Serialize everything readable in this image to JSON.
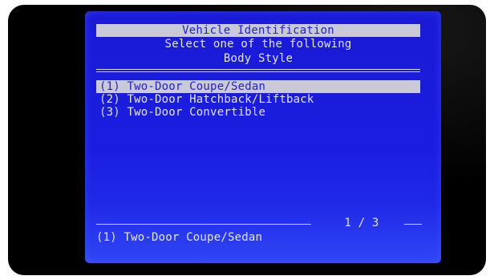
{
  "screen": {
    "title": "Vehicle Identification",
    "subtitle_line1": "Select one of the following",
    "subtitle_line2": "Body Style",
    "options": [
      {
        "label": "(1) Two-Door Coupe/Sedan",
        "selected": true
      },
      {
        "label": "(2) Two-Door Hatchback/Liftback",
        "selected": false
      },
      {
        "label": "(3) Two-Door Convertible",
        "selected": false
      }
    ],
    "page_indicator": "1 / 3",
    "status_text": "(1) Two-Door Coupe/Sedan"
  },
  "colors": {
    "screen_background": "#1a1ad6",
    "highlight_bar": "#c9c9d8",
    "highlight_text": "#2222cc",
    "text": "#e6e8ff"
  }
}
